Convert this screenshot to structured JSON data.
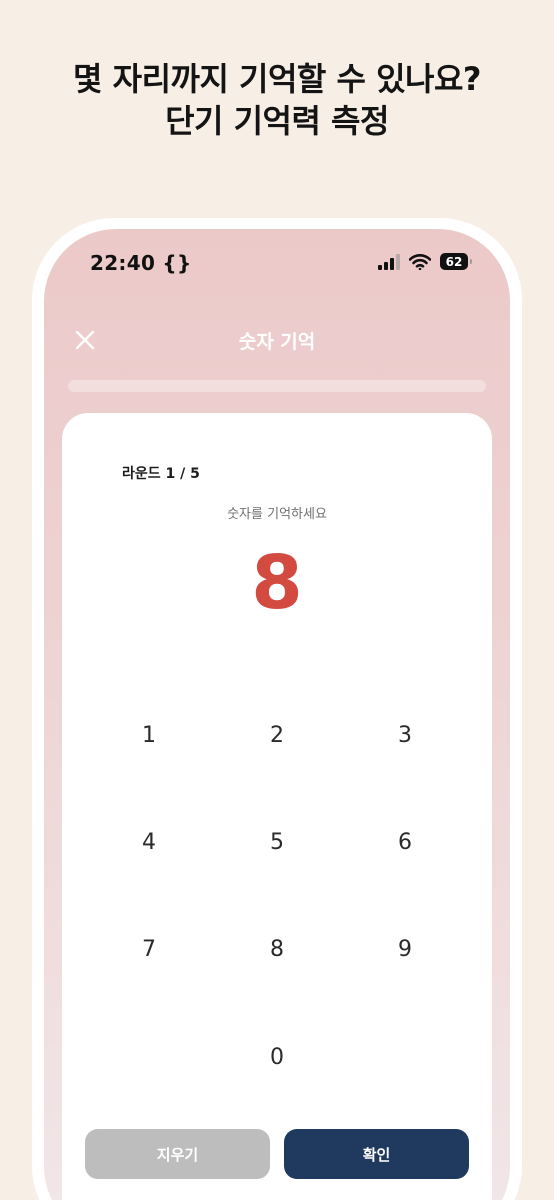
{
  "headline": {
    "line1": "몇 자리까지 기억할 수 있나요?",
    "line2": "단기 기억력 측정"
  },
  "status_bar": {
    "time": "22:40 {}",
    "battery": "62",
    "icons": [
      "signal-bars-icon",
      "wifi-icon",
      "battery-icon"
    ]
  },
  "nav": {
    "close_icon": "close-icon",
    "title": "숫자 기억"
  },
  "progress": {
    "value": 0
  },
  "game": {
    "round_label": "라운드 1 / 5",
    "instruction": "숫자를 기억하세요",
    "current_digit": "8"
  },
  "keypad": {
    "keys": [
      "1",
      "2",
      "3",
      "4",
      "5",
      "6",
      "7",
      "8",
      "9",
      "0"
    ]
  },
  "actions": {
    "clear_label": "지우기",
    "confirm_label": "확인"
  },
  "colors": {
    "background": "#f7eee6",
    "digit": "#d24a40",
    "confirm": "#1f3a5e",
    "clear": "#bdbdbd"
  }
}
